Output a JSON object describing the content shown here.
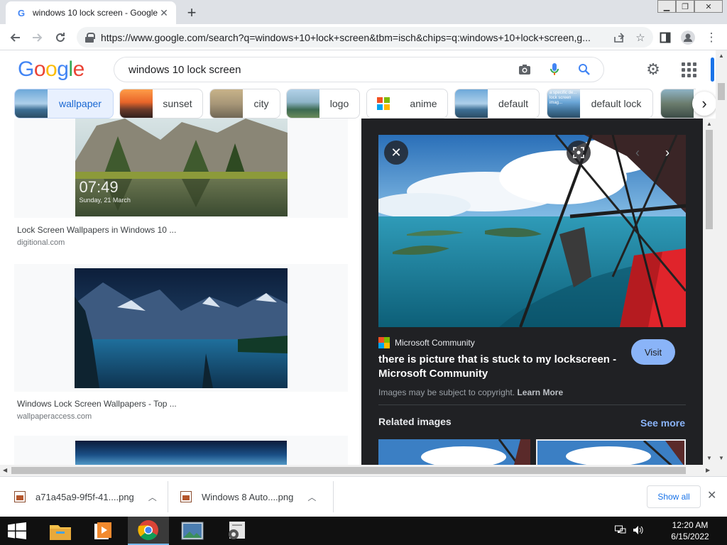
{
  "browser": {
    "tab_title": "windows 10 lock screen - Google",
    "tab_favicon": "G",
    "new_tab_symbol": "+",
    "url": "https://www.google.com/search?q=windows+10+lock+screen&tbm=isch&chips=q:windows+10+lock+screen,g..."
  },
  "google": {
    "logo_letters": [
      "G",
      "o",
      "o",
      "g",
      "l",
      "e"
    ],
    "logo_colors": [
      "#4285f4",
      "#ea4335",
      "#fbbc05",
      "#4285f4",
      "#34a853",
      "#ea4335"
    ],
    "query": "windows 10 lock screen",
    "chips": [
      {
        "label": "wallpaper",
        "active": true
      },
      {
        "label": "sunset",
        "active": false
      },
      {
        "label": "city",
        "active": false
      },
      {
        "label": "logo",
        "active": false
      },
      {
        "label": "anime",
        "active": false
      },
      {
        "label": "default",
        "active": false
      },
      {
        "label": "default lock",
        "active": false
      }
    ],
    "chip_thumb_text": "a specific de... lock screen imag..."
  },
  "results": [
    {
      "title": "Lock Screen Wallpapers in Windows 10 ...",
      "site": "digitional.com",
      "time": "07:49",
      "date": "Sunday, 21 March"
    },
    {
      "title": "Windows Lock Screen Wallpapers - Top ...",
      "site": "wallpaperaccess.com"
    }
  ],
  "preview": {
    "source": "Microsoft Community",
    "title": "there is picture that is stuck to my lockscreen - Microsoft Community",
    "visit_label": "Visit",
    "copyright_text": "Images may be subject to copyright.",
    "learn_more": "Learn More",
    "related_label": "Related images",
    "see_more": "See more"
  },
  "downloads": {
    "items": [
      "a71a45a9-9f5f-41....png",
      "Windows 8 Auto....png"
    ],
    "show_all": "Show all"
  },
  "taskbar": {
    "time": "12:20 AM",
    "date": "6/15/2022"
  },
  "colors": {
    "accent": "#1a73e8",
    "panel_bg": "#202124",
    "visit_button": "#8ab4f8"
  }
}
